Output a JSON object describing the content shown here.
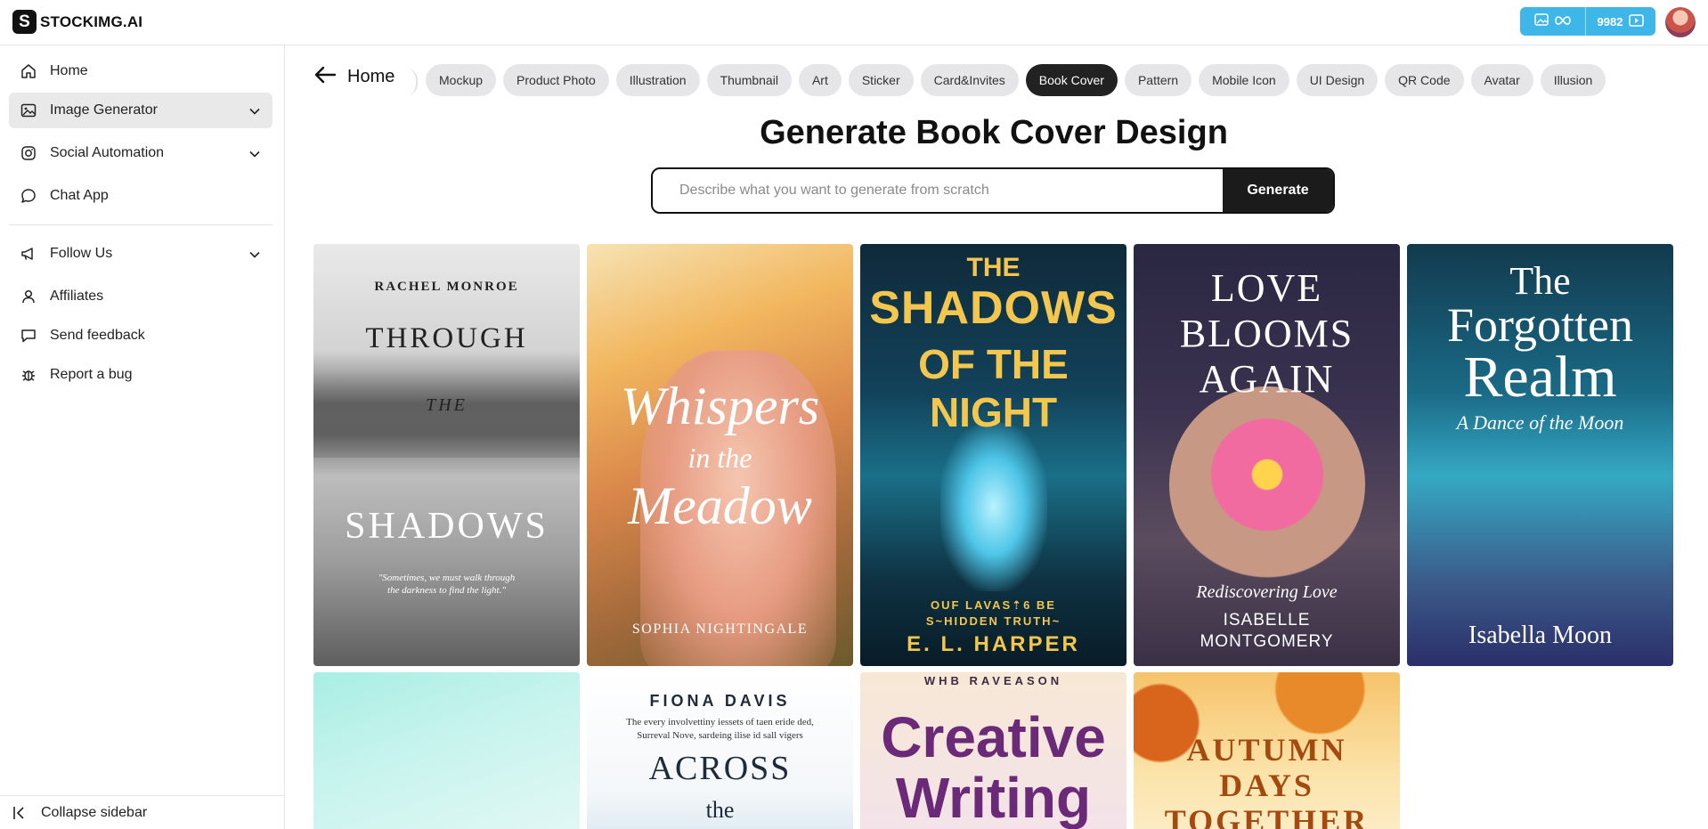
{
  "app": {
    "logo_letter": "S",
    "name": "STOCKIMG.AI"
  },
  "header": {
    "credits_value": "9982",
    "credits_icons": [
      "image-icon",
      "infinity-icon",
      "video-icon"
    ]
  },
  "sidebar": {
    "items": [
      {
        "label": "Home",
        "icon": "home-icon"
      },
      {
        "label": "Image Generator",
        "icon": "image-icon",
        "expandable": true,
        "active": true
      },
      {
        "label": "Social Automation",
        "icon": "instagram-icon",
        "expandable": true
      },
      {
        "label": "Chat App",
        "icon": "chat-icon"
      },
      {
        "label": "Follow Us",
        "icon": "megaphone-icon",
        "expandable": true
      },
      {
        "label": "Affiliates",
        "icon": "user-icon"
      },
      {
        "label": "Send feedback",
        "icon": "feedback-icon"
      },
      {
        "label": "Report a bug",
        "icon": "bug-icon"
      }
    ],
    "collapse_label": "Collapse sidebar"
  },
  "main": {
    "back_label": "Home",
    "categories": [
      "Mockup",
      "Product Photo",
      "Illustration",
      "Thumbnail",
      "Art",
      "Sticker",
      "Card&Invites",
      "Book Cover",
      "Pattern",
      "Mobile Icon",
      "UI Design",
      "QR Code",
      "Avatar",
      "Illusion"
    ],
    "selected_category": "Book Cover",
    "title": "Generate Book Cover Design",
    "prompt": {
      "placeholder": "Describe what you want to generate from scratch",
      "value": ""
    },
    "generate_label": "Generate"
  },
  "gallery": [
    {
      "author": "RACHEL MONROE",
      "title_1": "THROUGH",
      "title_2": "THE",
      "title_3": "SHADOWS",
      "quote_1": "\"Sometimes, we must walk through",
      "quote_2": "the darkness to find the light.\""
    },
    {
      "title_1": "Whispers",
      "title_2": "in the",
      "title_3": "Meadow",
      "author": "SOPHIA NIGHTINGALE"
    },
    {
      "title_1": "THE",
      "title_2": "SHADOWS",
      "title_3": "OF THE NIGHT",
      "tagline_1": "OUF LAVAS⇡6 BE",
      "tagline_2": "S~HIDDEN TRUTH~",
      "author": "E. L. HARPER"
    },
    {
      "title_1": "LOVE",
      "title_2": "BLOOMS",
      "title_3": "AGAIN",
      "subtitle": "Rediscovering Love",
      "author_1": "ISABELLE",
      "author_2": "MONTGOMERY"
    },
    {
      "title_1": "The",
      "title_2": "Forgotten",
      "title_3": "Realm",
      "subtitle": "A Dance of the Moon",
      "author": "Isabella Moon"
    },
    {},
    {
      "author": "FIONA DAVIS",
      "blurb_1": "The every involvettiny iessets of taen eride ded,",
      "blurb_2": "Surreval Nove, sardeing ilise id sall vigers",
      "title_1": "ACROSS",
      "title_2": "the"
    },
    {
      "author": "WHB RAVEASON",
      "title_1": "Creative",
      "title_2": "Writing"
    },
    {
      "title_1": "AUTUMN",
      "title_2": "DAYS",
      "title_3": "TOGETHER"
    }
  ],
  "colors": {
    "accent": "#3fb6e8",
    "chip_selected": "#222222",
    "chip": "#e6e6e8"
  }
}
